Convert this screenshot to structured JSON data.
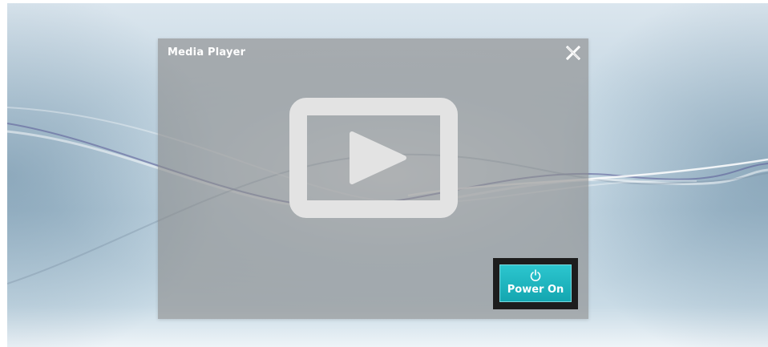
{
  "window": {
    "title": "Media Player",
    "close_icon": "close-icon"
  },
  "player": {
    "center_icon": "video-play-icon"
  },
  "power_button": {
    "label": "Power On",
    "icon": "power-icon",
    "color": "#1aaeb8"
  },
  "colors": {
    "panel": "#8a8a8a",
    "accent": "#1aaeb8",
    "background": "#c4d6e2"
  }
}
